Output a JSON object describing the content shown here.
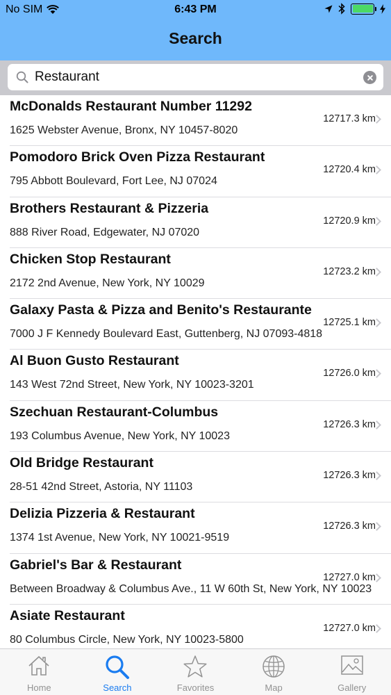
{
  "status_bar": {
    "carrier": "No SIM",
    "time": "6:43 PM"
  },
  "nav": {
    "title": "Search"
  },
  "search": {
    "query": "Restaurant"
  },
  "results": [
    {
      "name": "McDonalds Restaurant Number 11292",
      "address": "1625 Webster Avenue, Bronx, NY 10457-8020",
      "distance": "12717.3 km"
    },
    {
      "name": "Pomodoro Brick Oven Pizza  Restaurant",
      "address": "795 Abbott Boulevard, Fort Lee, NJ 07024",
      "distance": "12720.4 km"
    },
    {
      "name": "Brothers Restaurant & Pizzeria",
      "address": "888 River Road, Edgewater, NJ 07020",
      "distance": "12720.9 km"
    },
    {
      "name": "Chicken Stop Restaurant",
      "address": "2172 2nd Avenue, New York, NY 10029",
      "distance": "12723.2 km"
    },
    {
      "name": "Galaxy Pasta & Pizza and Benito's Restaurante",
      "address": "7000 J F Kennedy Boulevard East, Guttenberg, NJ 07093-4818",
      "distance": "12725.1 km"
    },
    {
      "name": "Al Buon Gusto Restaurant",
      "address": "143 West 72nd Street, New York, NY 10023-3201",
      "distance": "12726.0 km"
    },
    {
      "name": "Szechuan Restaurant-Columbus",
      "address": "193 Columbus Avenue, New York, NY 10023",
      "distance": "12726.3 km"
    },
    {
      "name": "Old Bridge Restaurant",
      "address": "28-51 42nd Street, Astoria, NY 11103",
      "distance": "12726.3 km"
    },
    {
      "name": "Delizia Pizzeria & Restaurant",
      "address": "1374 1st Avenue, New York, NY 10021-9519",
      "distance": "12726.3 km"
    },
    {
      "name": "Gabriel's Bar & Restaurant",
      "address": "Between Broadway & Columbus Ave., 11 W 60th St, New York, NY 10023",
      "distance": "12727.0 km"
    },
    {
      "name": "Asiate Restaurant",
      "address": "80 Columbus Circle, New York, NY 10023-5800",
      "distance": "12727.0 km"
    }
  ],
  "tabs": [
    {
      "label": "Home",
      "icon": "home-icon"
    },
    {
      "label": "Search",
      "icon": "search-icon",
      "active": true
    },
    {
      "label": "Favorites",
      "icon": "star-icon"
    },
    {
      "label": "Map",
      "icon": "globe-icon"
    },
    {
      "label": "Gallery",
      "icon": "image-icon"
    }
  ],
  "colors": {
    "header": "#6fb8fb",
    "tab_active": "#1a7cf0",
    "tab_inactive": "#929292",
    "battery": "#4cd964"
  }
}
